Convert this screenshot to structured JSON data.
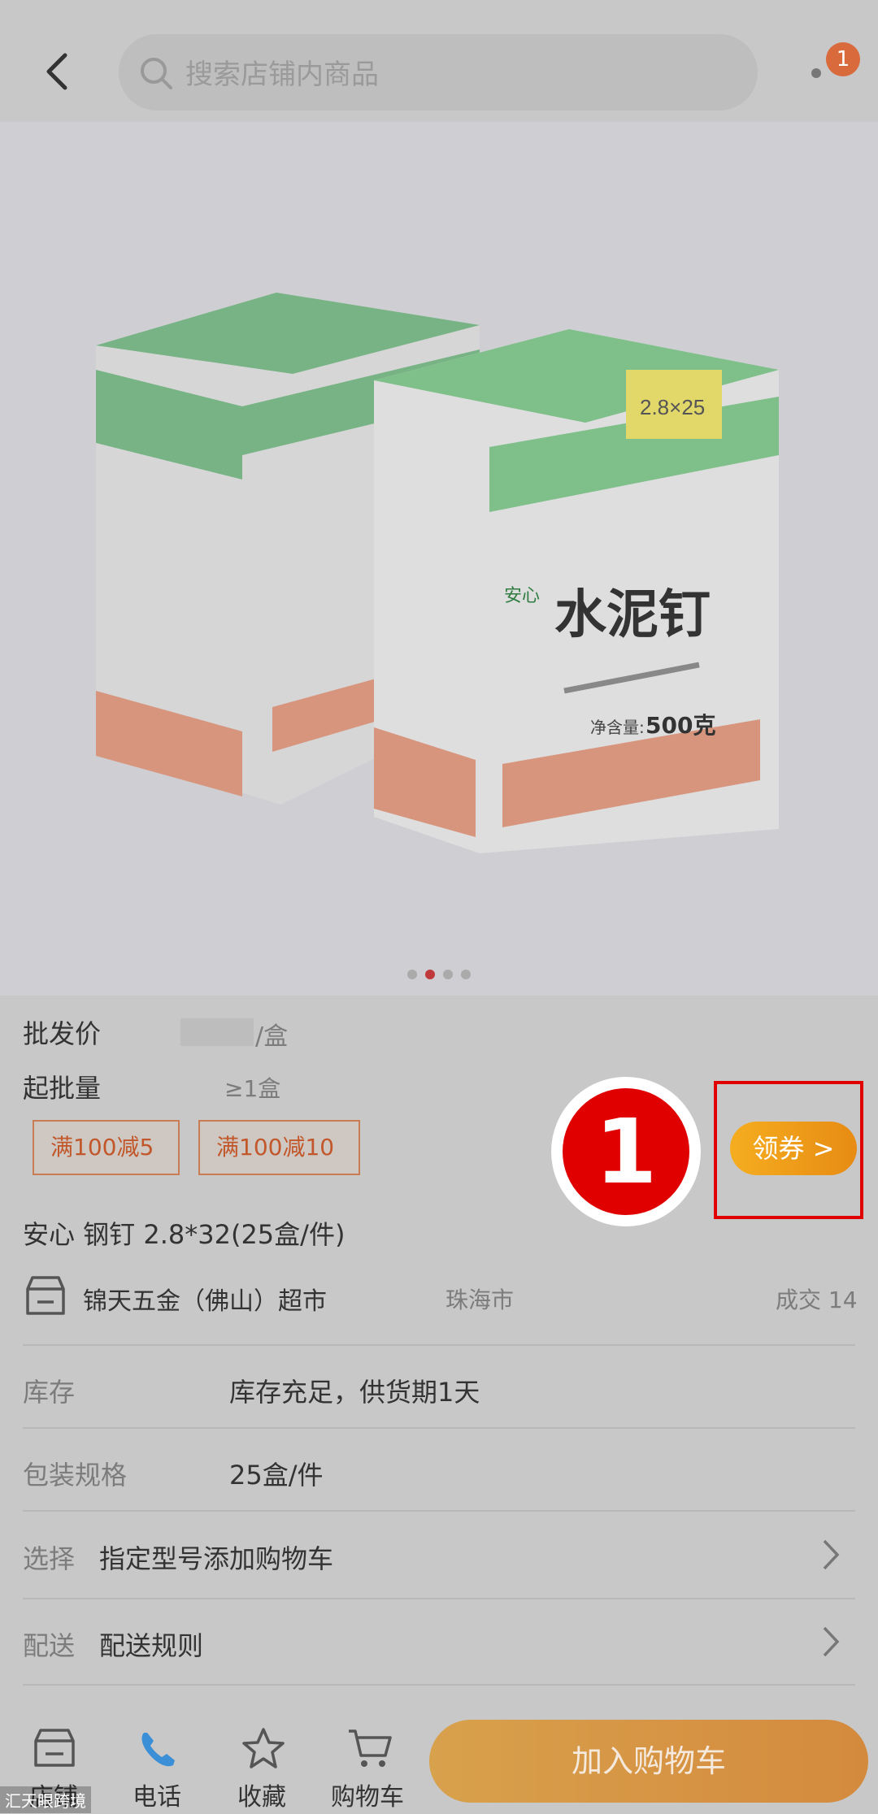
{
  "header": {
    "search_placeholder": "搜索店铺内商品",
    "badge_count": "1"
  },
  "product_image": {
    "box_brand": "安心",
    "box_title": "水泥钉",
    "box_weight_label": "净含量:",
    "box_weight": "500克",
    "box_size": "2.8×25",
    "carousel_total": 4,
    "carousel_active": 2
  },
  "pricing": {
    "wholesale_label": "批发价",
    "wholesale_unit": "/盒",
    "min_qty_label": "起批量",
    "min_qty_value": "≥1盒"
  },
  "coupons": [
    "满100减5",
    "满100减10"
  ],
  "coupon_button": "领券 >",
  "marker_number": "1",
  "product": {
    "title": "安心 钢钉 2.8*32(25盒/件)",
    "store_name": "锦天五金（佛山）超市",
    "store_city": "珠海市",
    "deals": "成交 14"
  },
  "details": [
    {
      "label": "库存",
      "value": "库存充足，供货期1天"
    },
    {
      "label": "包装规格",
      "value": "25盒/件"
    }
  ],
  "options": [
    {
      "label": "选择",
      "value": "指定型号添加购物车"
    },
    {
      "label": "配送",
      "value": "配送规则"
    }
  ],
  "bottom_nav": {
    "store": "店铺",
    "phone": "电话",
    "favorite": "收藏",
    "cart": "购物车",
    "add_to_cart": "加入购物车"
  },
  "watermark": "汇天眼跨境",
  "colors": {
    "accent": "#e00000",
    "coupon_button": "#f5ad1f",
    "cart_button": "#d8a14c",
    "carousel_active": "#c0393b"
  }
}
